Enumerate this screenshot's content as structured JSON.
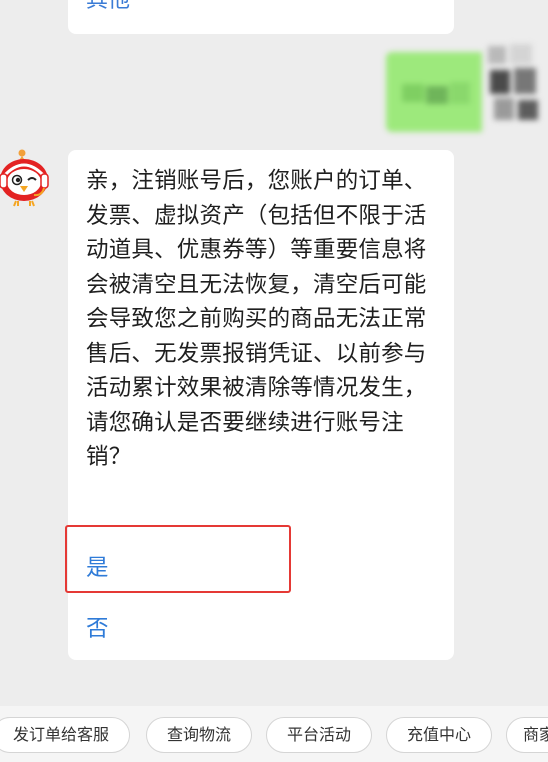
{
  "previous_bubble": {
    "option_label": "其他"
  },
  "bot_message": {
    "text": "亲，注销账号后，您账户的订单、发票、虚拟资产（包括但不限于活动道具、优惠券等）等重要信息将会被清空且无法恢复，清空后可能会导致您之前购买的商品无法正常售后、无发票报销凭证、以前参与活动累计效果被清除等情况发生，请您确认是否要继续进行账号注销？",
    "options": [
      {
        "label": "是",
        "highlighted": true
      },
      {
        "label": "否",
        "highlighted": false
      }
    ]
  },
  "quick_replies": [
    {
      "label": "发订单给客服"
    },
    {
      "label": "查询物流"
    },
    {
      "label": "平台活动"
    },
    {
      "label": "充值中心"
    },
    {
      "label": "商家"
    }
  ],
  "colors": {
    "background": "#ededed",
    "option_text": "#2f7bd8",
    "highlight_border": "#e53935",
    "user_bubble": "#9de97c"
  },
  "icons": {
    "bot_avatar": "red-bird-mascot-icon"
  }
}
